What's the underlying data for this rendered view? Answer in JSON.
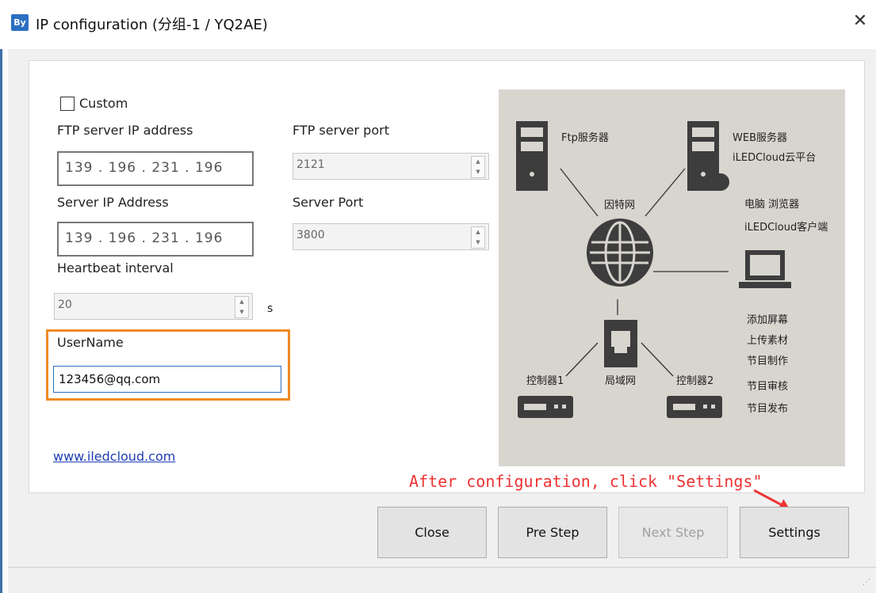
{
  "window": {
    "title": "IP configuration  (分组-1 / YQ2AE)",
    "app_icon_text": "By",
    "close_glyph": "✕"
  },
  "form": {
    "custom_checkbox_label": "Custom",
    "custom_checked": false,
    "ftp_ip_label": "FTP server IP address",
    "ftp_ip_value": "139 . 196 . 231 . 196",
    "ftp_port_label": "FTP server port",
    "ftp_port_value": "2121",
    "server_ip_label": "Server IP Address",
    "server_ip_value": "139 . 196 . 231 . 196",
    "server_port_label": "Server Port",
    "server_port_value": "3800",
    "heartbeat_label": "Heartbeat interval",
    "heartbeat_value": "20",
    "heartbeat_unit": "s",
    "username_label": "UserName",
    "username_value": "123456@qq.com",
    "website_link": "www.iledcloud.com"
  },
  "diagram": {
    "ftp_server": "Ftp服务器",
    "web_server_line1": "WEB服务器",
    "web_server_line2": "iLEDCloud云平台",
    "internet": "因特网",
    "pc_line1": "电脑  浏览器",
    "pc_line2": "iLEDCloud客户端",
    "lan": "局域网",
    "controller1": "控制器1",
    "controller2": "控制器2",
    "features": [
      "添加屏幕",
      "上传素材",
      "节目制作",
      "节目审核",
      "节目发布"
    ]
  },
  "annotation": "After configuration, click \"Settings\"",
  "buttons": {
    "close": "Close",
    "pre_step": "Pre Step",
    "next_step": "Next Step",
    "settings": "Settings"
  },
  "colors": {
    "highlight_border": "#f08a24",
    "annotation_text": "#e33333",
    "link": "#1f3fb5",
    "focused_input_border": "#2e6fbd"
  }
}
